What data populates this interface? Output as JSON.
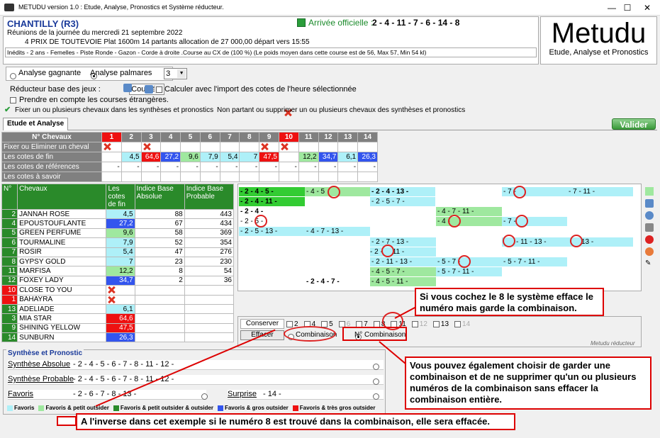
{
  "window": {
    "title": "METUDU version 1.0  : Etude, Analyse, Pronostics et Système réducteur.",
    "minimize": "—",
    "maximize": "☐",
    "close": "✕"
  },
  "header": {
    "race": "CHANTILLY (R3)",
    "arrivee_label": "Arrivée officielle :",
    "arrivee": "2 - 4 - 11 - 7 - 6 - 14 - 8",
    "date_line": "Réunions de la journée du mercredi 21 septembre 2022",
    "prize_line": "4 PRIX DE TOUTEVOIE Plat 1600m 14 partants allocation de 27 000,00 départ vers 15:55",
    "info": "Inédits - 2 ans - Femelles - Piste Ronde - Gazon - Corde à droite .Course au CX de (100 %)  (Le poids moyen dans cette course est de 56, Max 57, Min 54 kl)"
  },
  "logo": {
    "big": "Metudu",
    "small": "Etude, Analyse et Pronostics"
  },
  "options": {
    "analyse_gagnante": "Analyse gagnante",
    "analyse_palmares": "Analyse palmares",
    "palmares_value": "3",
    "reducteur_label": "Réducteur base des jeux :",
    "reducteur_value": "Couplé",
    "calculer": "Calculer avec l'import des cotes de l'heure sélectionnée",
    "prendre": "Prendre en compte les courses étrangères.",
    "fixer": "Fixer un ou plusieurs chevaux dans les synthèses et pronostics",
    "non_partant": "Non partant ou supprimer un ou plusieurs chevaux des synthèses et pronostics"
  },
  "tab": {
    "label": "Etude et Analyse",
    "valider": "Valider"
  },
  "grid": {
    "header": "N° Chevaux",
    "numbers": [
      "1",
      "2",
      "3",
      "4",
      "5",
      "6",
      "7",
      "8",
      "9",
      "10",
      "11",
      "12",
      "13",
      "14"
    ],
    "rows": [
      "Fixer ou Eliminer un cheval",
      "Les cotes de fin",
      "Les cotes de références",
      "Les cotes à savoir"
    ],
    "cotes": [
      "",
      "4,5",
      "64,6",
      "27,2",
      "9,6",
      "7,9",
      "5,4",
      "7",
      "47,5",
      "",
      "12,2",
      "34,7",
      "6,1",
      "26,3"
    ],
    "cotes_colors": [
      "",
      "#aef0f8",
      "#ee1111",
      "#3355ee",
      "#9fe89f",
      "#aef0f8",
      "#aef0f8",
      "#aef0f8",
      "#ee1111",
      "",
      "#9fe89f",
      "#3355ee",
      "#aef0f8",
      "#3355ee"
    ],
    "ref": [
      "-",
      "-",
      "-",
      "-",
      "-",
      "-",
      "-",
      "-",
      "-",
      "-",
      "-",
      "-",
      "-",
      "-"
    ]
  },
  "horses": {
    "h_num": "N°",
    "h_name": "Chevaux",
    "h_cotes": "Les cotes de fin",
    "h_abs": "Indice Base Absolue",
    "h_prob": "Indice Base Probable",
    "rows": [
      {
        "n": "2",
        "name": "JANNAH ROSE",
        "cote": "4,5",
        "abs": "88",
        "prob": "443",
        "c": "#aef0f8",
        "nc": "#2a8a2a"
      },
      {
        "n": "4",
        "name": "EPOUSTOUFLANTE",
        "cote": "27,2",
        "abs": "67",
        "prob": "434",
        "c": "#3355ee",
        "nc": "#2a8a2a"
      },
      {
        "n": "5",
        "name": "GREEN PERFUME",
        "cote": "9,6",
        "abs": "58",
        "prob": "369",
        "c": "#9fe89f",
        "nc": "#2a8a2a"
      },
      {
        "n": "6",
        "name": "TOURMALINE",
        "cote": "7,9",
        "abs": "52",
        "prob": "354",
        "c": "#aef0f8",
        "nc": "#2a8a2a"
      },
      {
        "n": "7",
        "name": "ROSIR",
        "cote": "5,4",
        "abs": "47",
        "prob": "276",
        "c": "#aef0f8",
        "nc": "#2a8a2a"
      },
      {
        "n": "8",
        "name": "GYPSY GOLD",
        "cote": "7",
        "abs": "23",
        "prob": "230",
        "c": "#aef0f8",
        "nc": "#2a8a2a"
      },
      {
        "n": "11",
        "name": "MARFISA",
        "cote": "12,2",
        "abs": "8",
        "prob": "54",
        "c": "#9fe89f",
        "nc": "#2a8a2a"
      },
      {
        "n": "12",
        "name": "FOXEY LADY",
        "cote": "34,7",
        "abs": "2",
        "prob": "36",
        "c": "#3355ee",
        "nc": "#2a8a2a"
      },
      {
        "n": "10",
        "name": "CLOSE TO YOU",
        "cote": "",
        "abs": "",
        "prob": "",
        "c": "#fff",
        "nc": "#ee1111",
        "x": true
      },
      {
        "n": "1",
        "name": "BAHAYRA",
        "cote": "",
        "abs": "",
        "prob": "",
        "c": "#fff",
        "nc": "#ee1111",
        "x": true
      },
      {
        "n": "13",
        "name": "ADELIADE",
        "cote": "6,1",
        "abs": "",
        "prob": "",
        "c": "#aef0f8",
        "nc": "#2a8a2a"
      },
      {
        "n": "3",
        "name": "MIA STAR",
        "cote": "64,6",
        "abs": "",
        "prob": "",
        "c": "#ee1111",
        "nc": "#2a8a2a"
      },
      {
        "n": "9",
        "name": "SHINING YELLOW",
        "cote": "47,5",
        "abs": "",
        "prob": "",
        "c": "#ee1111",
        "nc": "#2a8a2a"
      },
      {
        "n": "14",
        "name": "SUNBURN",
        "cote": "26,3",
        "abs": "",
        "prob": "",
        "c": "#3355ee",
        "nc": "#2a8a2a"
      }
    ]
  },
  "combos": [
    "- 2 - 4 - 5 -",
    "- 4 - 5",
    "- 2 - 4 - 13 -",
    "- 7 -",
    "- 7 - 11 -",
    "- 2 - 4 - 11 -",
    "- 2 - 5 - 7 -",
    "- 2 - 4 -",
    "- 4 - 7 - 11 -",
    "- 2 - 5 -",
    "- 4 -",
    "11 -",
    "- 7 -",
    "11 -",
    "- 2 - 5 - 13 -",
    "- 4 - 7 - 13 -",
    "- 2 - 7 - 13 -",
    "- 11 - 13 -",
    "13 -",
    "- 2 -",
    "11 -",
    "- 2 - 11 - 13 -",
    "- 5 - 7 -",
    "- 5 - 7 - 11 -",
    "- 4 - 5 - 7 -",
    "- 5 - 7 - 11 -",
    "- 2 - 4 - 7 -",
    "- 4 - 5 - 11 -",
    "8"
  ],
  "reducteur": {
    "conserver": "Conserver",
    "effacer": "Effacer",
    "combinaison": "Combinaison",
    "n_combinaison": "N° Combinaison",
    "footer": "Metudu réducteur",
    "nums": [
      "2",
      "4",
      "5",
      "6",
      "7",
      "8",
      "11",
      "12",
      "13",
      "14"
    ]
  },
  "synth": {
    "title": "Synthèse et Pronostic",
    "absolue_label": "Synthèse Absolue",
    "absolue": "- 2 - 4 - 5 - 6 - 7 - 8 - 11 - 12 -",
    "probable_label": "Synthèse Probable",
    "probable": "- 2 - 4 - 5 - 6 - 7 - 8 - 11 - 12 -",
    "favoris_label": "Favoris",
    "favoris": "- 2 - 6 - 7 - 8 - 13 -",
    "surprise_label": "Surprise",
    "surprise": "- 14 -"
  },
  "legend": [
    "Favoris",
    "Favoris & petit outsider",
    "Favoris & petit outsider & outsider",
    "Favoris & gros outsider",
    "Favoris & très gros outsider"
  ],
  "legend_colors": [
    "#aef0f8",
    "#9fe89f",
    "#2a8a2a",
    "#3355ee",
    "#ee1111"
  ],
  "annotations": {
    "a1": "Si vous cochez le 8 le système efface le numéro mais garde la combinaison.",
    "a2": "Vous pouvez également choisir de garder une combinaison et de ne supprimer qu'un ou plusieurs numéros de la combinaison sans effacer la combinaison entière.",
    "a3": "A l'inverse dans cet exemple si le numéro 8 est trouvé dans la combinaison, elle sera effacée."
  }
}
